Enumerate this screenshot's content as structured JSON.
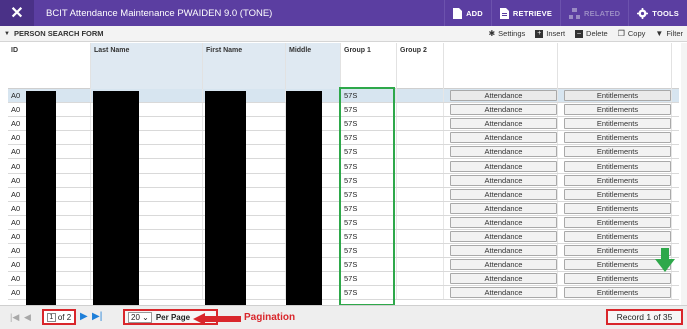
{
  "topbar": {
    "close_icon": "close-icon",
    "title": "BCIT Attendance Maintenance PWAIDEN 9.0 (TONE)",
    "buttons": [
      {
        "label": "ADD",
        "icon": "add-document-icon",
        "disabled": false
      },
      {
        "label": "RETRIEVE",
        "icon": "retrieve-document-icon",
        "disabled": false
      },
      {
        "label": "RELATED",
        "icon": "related-icon",
        "disabled": true
      },
      {
        "label": "TOOLS",
        "icon": "gear-icon",
        "disabled": false
      }
    ]
  },
  "section": {
    "title": "PERSON SEARCH FORM",
    "tools": {
      "settings": "Settings",
      "insert": "Insert",
      "delete": "Delete",
      "copy": "Copy",
      "filter": "Filter"
    }
  },
  "table": {
    "headers": {
      "id": "ID",
      "last": "Last Name",
      "first": "First Name",
      "middle": "Middle",
      "group1": "Group 1",
      "group2": "Group 2"
    },
    "rows": [
      {
        "id": "A0",
        "group1": "57S",
        "attendance": "Attendance",
        "entitlements": "Entitlements"
      },
      {
        "id": "A0",
        "group1": "57S",
        "attendance": "Attendance",
        "entitlements": "Entitlements"
      },
      {
        "id": "A0",
        "group1": "57S",
        "attendance": "Attendance",
        "entitlements": "Entitlements"
      },
      {
        "id": "A0",
        "group1": "57S",
        "attendance": "Attendance",
        "entitlements": "Entitlements"
      },
      {
        "id": "A0",
        "group1": "57S",
        "attendance": "Attendance",
        "entitlements": "Entitlements"
      },
      {
        "id": "A0",
        "group1": "57S",
        "attendance": "Attendance",
        "entitlements": "Entitlements"
      },
      {
        "id": "A0",
        "group1": "57S",
        "attendance": "Attendance",
        "entitlements": "Entitlements"
      },
      {
        "id": "A0",
        "group1": "57S",
        "attendance": "Attendance",
        "entitlements": "Entitlements"
      },
      {
        "id": "A0",
        "group1": "57S",
        "attendance": "Attendance",
        "entitlements": "Entitlements"
      },
      {
        "id": "A0",
        "group1": "57S",
        "attendance": "Attendance",
        "entitlements": "Entitlements"
      },
      {
        "id": "A0",
        "group1": "57S",
        "attendance": "Attendance",
        "entitlements": "Entitlements"
      },
      {
        "id": "A0",
        "group1": "57S",
        "attendance": "Attendance",
        "entitlements": "Entitlements"
      },
      {
        "id": "A0",
        "group1": "57S",
        "attendance": "Attendance",
        "entitlements": "Entitlements"
      },
      {
        "id": "A0",
        "group1": "57S",
        "attendance": "Attendance",
        "entitlements": "Entitlements"
      },
      {
        "id": "A0",
        "group1": "57S",
        "attendance": "Attendance",
        "entitlements": "Entitlements"
      }
    ]
  },
  "pagination": {
    "page_current": "1",
    "page_of": "of 2",
    "per_page_value": "20",
    "per_page_label": "Per Page",
    "annotation": "Pagination",
    "record": "Record 1 of 35"
  },
  "colors": {
    "topbar": "#5b3ea1",
    "highlight_box": "#2ea84a",
    "annotation_red": "#d9262b",
    "selected_row": "#d7e5f0"
  }
}
